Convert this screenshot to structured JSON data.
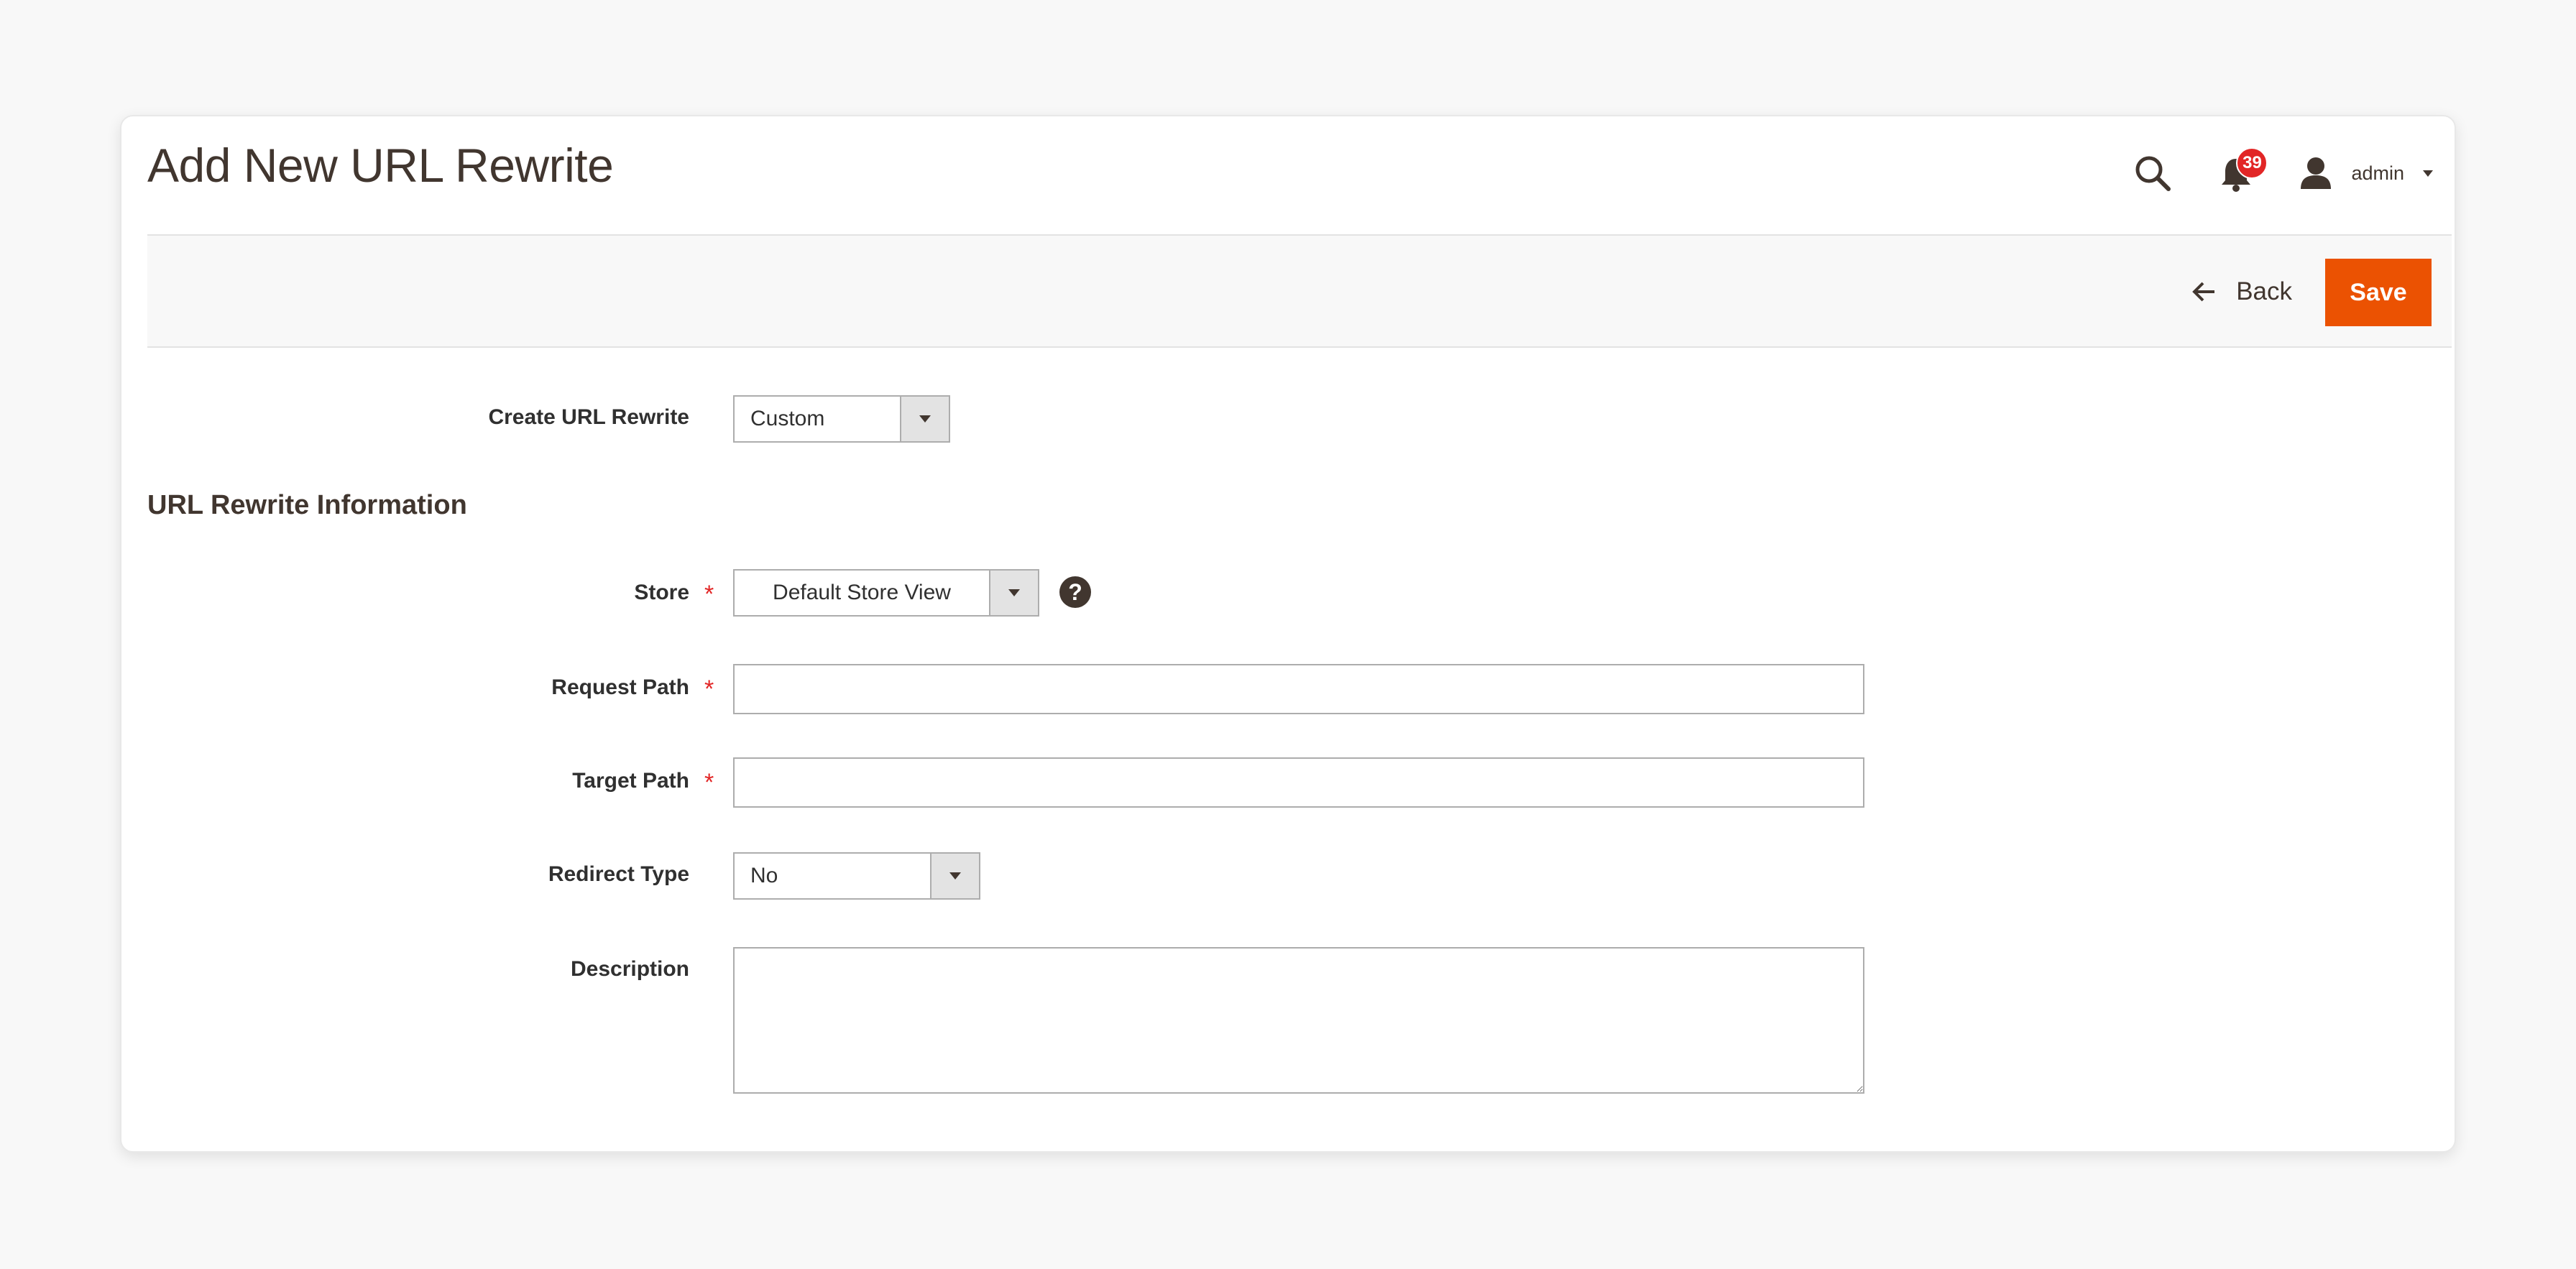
{
  "header": {
    "title": "Add New URL Rewrite",
    "notification_count": "39",
    "user_name": "admin"
  },
  "actions": {
    "back_label": "Back",
    "save_label": "Save"
  },
  "form": {
    "create_url_rewrite": {
      "label": "Create URL Rewrite",
      "value": "Custom"
    },
    "section_title": "URL Rewrite Information",
    "store": {
      "label": "Store",
      "value": "Default Store View",
      "required_mark": "*",
      "help_symbol": "?"
    },
    "request_path": {
      "label": "Request Path",
      "value": "",
      "required_mark": "*"
    },
    "target_path": {
      "label": "Target Path",
      "value": "",
      "required_mark": "*"
    },
    "redirect_type": {
      "label": "Redirect Type",
      "value": "No"
    },
    "description": {
      "label": "Description",
      "value": ""
    }
  },
  "colors": {
    "accent": "#eb5202",
    "badge": "#e22626",
    "text": "#41362f"
  }
}
